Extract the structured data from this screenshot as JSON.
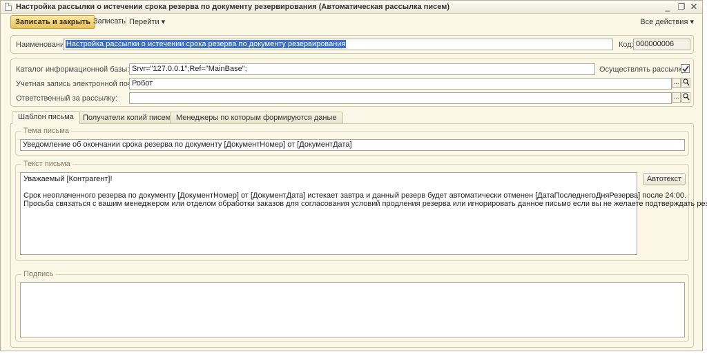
{
  "window": {
    "title": "Настройка рассылки о истечении срока резерва по документу резервирования (Автоматическая рассылка писем)",
    "minimize_glyph": "_",
    "maximize_glyph": "❐",
    "close_glyph": "✕"
  },
  "toolbar": {
    "save_close_label": "Записать и закрыть",
    "save_label": "Записать",
    "goto_label": "Перейти ▾",
    "all_actions_label": "Все действия ▾"
  },
  "header": {
    "name_label": "Наименование:",
    "name_value": "Настройка рассылки о истечении срока резерва по документу резервирования",
    "code_label": "Код:",
    "code_value": "000000006"
  },
  "settings": {
    "catalog_label": "Каталог информационной базы:",
    "catalog_value": "Srvr=\"127.0.0.1\";Ref=\"MainBase\";",
    "send_label": "Осуществлять рассылку:",
    "send_checked": true,
    "email_label": "Учетная запись электронной почты:",
    "email_value": "Робот",
    "responsible_label": "Ответственный за рассылку:",
    "responsible_value": "",
    "dots": "...",
    "search_icon": "magnifier-icon"
  },
  "tabs": [
    {
      "label": "Шаблон письма",
      "active": true
    },
    {
      "label": "Получатели копий писем",
      "active": false
    },
    {
      "label": "Менеджеры по которым формируются даные",
      "active": false
    }
  ],
  "subject": {
    "title": "Тема письма",
    "value": "Уведомление об окончании срока резерва по документу [ДокументНомер] от [ДокументДата]"
  },
  "body": {
    "title": "Текст письма",
    "lines": [
      "Уважаемый [Контрагент]!",
      "",
      "Срок неоплаченного резерва по документу [ДокументНомер] от [ДокументДата] истекает завтра и данный резерв будет автоматически отменен [ДатаПоследнегоДняРезерва] после 24:00.",
      "Просьба связаться с вашим менеджером или отделом обработки заказов для согласования условий продления резерва или игнорировать данное письмо если вы не желаете подтверждать резерв."
    ],
    "autotext_label": "Автотекст"
  },
  "signature": {
    "title": "Подпись",
    "value": ""
  }
}
